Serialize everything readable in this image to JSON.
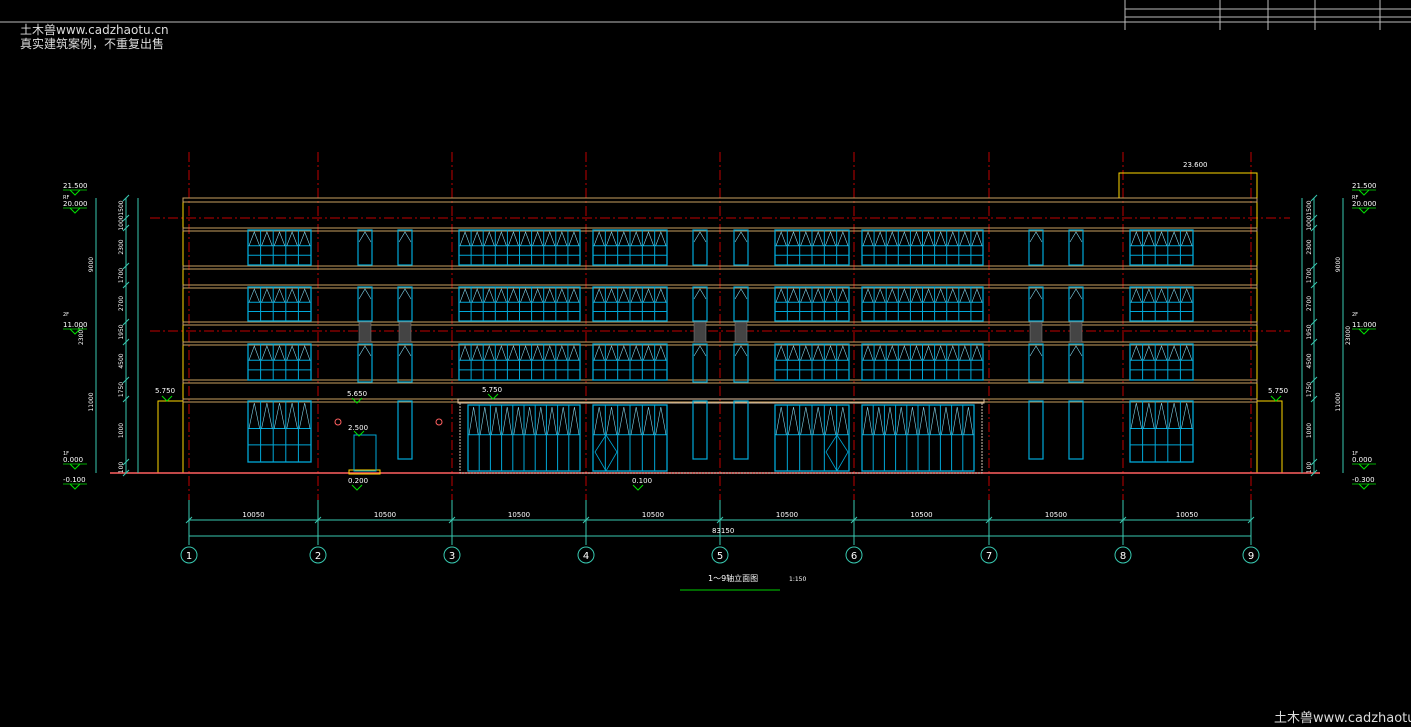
{
  "watermark": {
    "site": "土木兽www.cadzhaotu.cn",
    "notice": "真实建筑案例，不重复出售",
    "bottom": "土木兽www.cadzhaotu.c"
  },
  "drawing": {
    "title": "1～9轴立面图",
    "scale": "1:150",
    "axes": [
      "1",
      "2",
      "3",
      "4",
      "5",
      "6",
      "7",
      "8",
      "9"
    ],
    "spans": [
      "10050",
      "10500",
      "10500",
      "10500",
      "10500",
      "10500",
      "10500",
      "10050"
    ],
    "total_span": "83150",
    "elevations_left": [
      "21.500",
      "20.000",
      "11.000",
      "0.000",
      "-0.100"
    ],
    "elevations_right": [
      "21.500",
      "20.000",
      "11.000",
      "0.000",
      "-0.300"
    ],
    "floor_tags": [
      "RF",
      "2F",
      "1F"
    ],
    "dims_vertical": [
      "1500",
      "1000",
      "2300",
      "1700",
      "2700",
      "1950",
      "4500",
      "1750",
      "1000",
      "100"
    ],
    "dims_total": [
      "9000",
      "11000",
      "23000"
    ],
    "marks": {
      "parapet_top": "23.600",
      "canopy_left": "5.750",
      "canopy_right": "5.750",
      "entrance_canopy": "5.650",
      "shop_canopy": "5.750",
      "door_head": "2.500",
      "door_sill": "0.200",
      "ground": "0.100"
    }
  },
  "colors": {
    "background": "#000000",
    "axis_line": "#c00000",
    "outline": "#ffd700",
    "slab": "#c8a060",
    "window": "#00a8d8",
    "dimension": "#38c8b0",
    "label": "#ffffff",
    "elevation_mark": "#00e000",
    "ground": "#ff6060"
  }
}
